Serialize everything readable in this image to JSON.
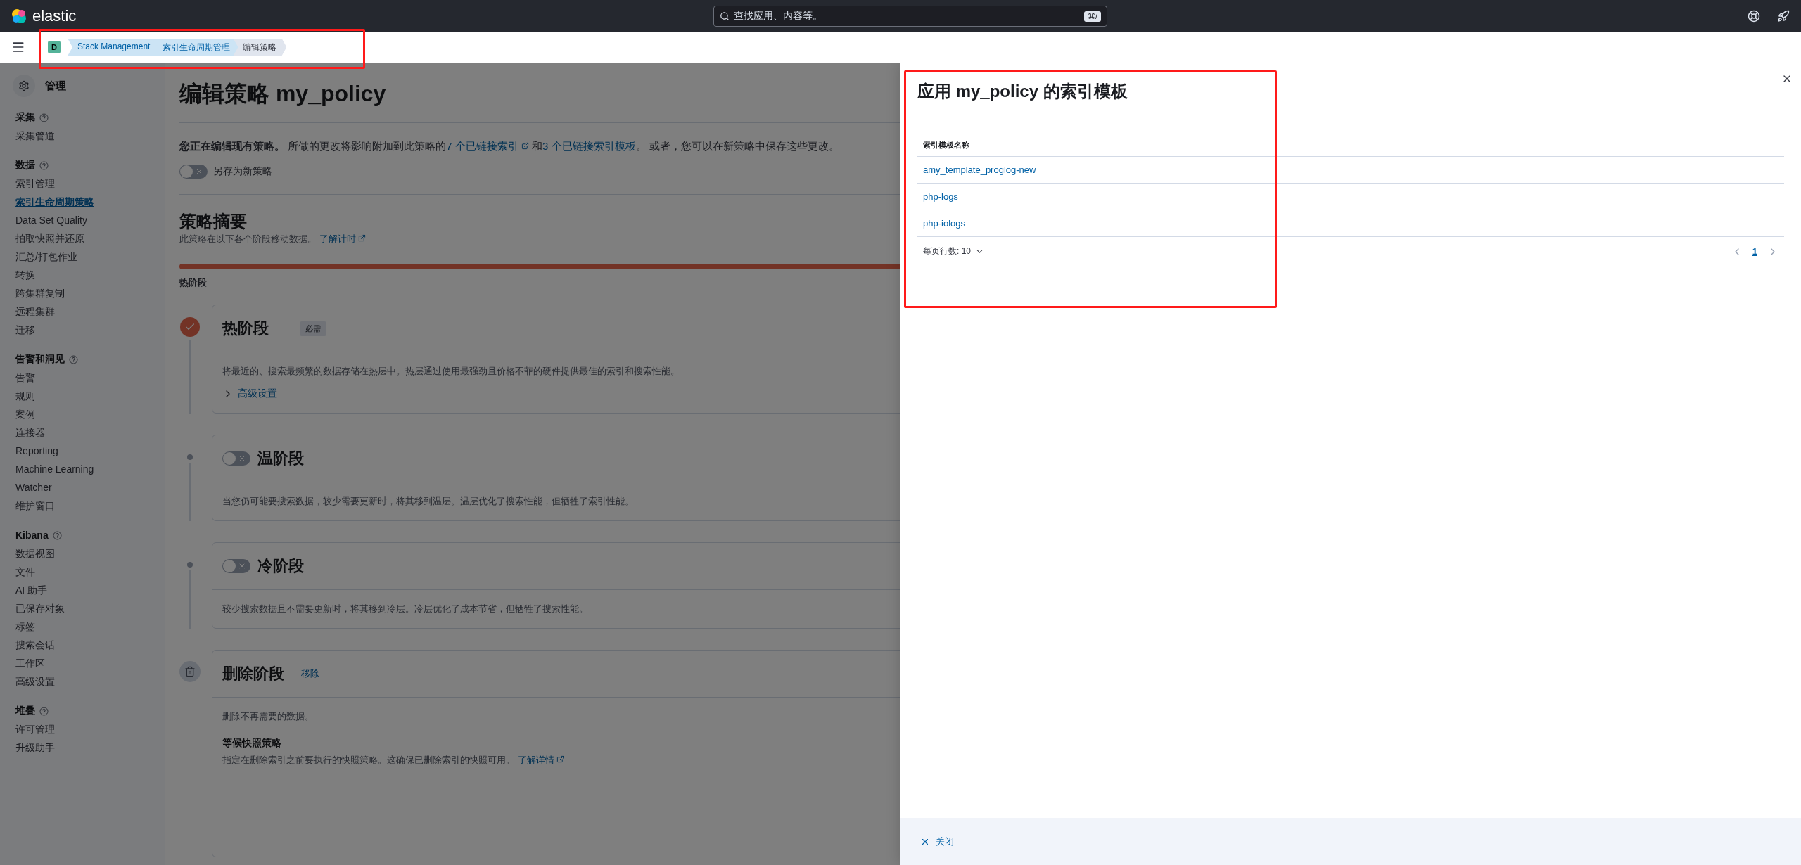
{
  "header": {
    "logo_text": "elastic",
    "search_placeholder": "查找应用、内容等。",
    "search_shortcut": "⌘/"
  },
  "breadcrumbs": {
    "space": "D",
    "items": [
      {
        "label": "Stack Management",
        "selected": false
      },
      {
        "label": "索引生命周期管理",
        "selected": false
      },
      {
        "label": "编辑策略",
        "selected": true
      }
    ]
  },
  "sidebar": {
    "title": "管理",
    "groups": [
      {
        "title": "采集",
        "items": [
          {
            "label": "采集管道",
            "selected": false
          }
        ]
      },
      {
        "title": "数据",
        "items": [
          {
            "label": "索引管理",
            "selected": false
          },
          {
            "label": "索引生命周期策略",
            "selected": true
          },
          {
            "label": "Data Set Quality",
            "selected": false
          },
          {
            "label": "拍取快照并还原",
            "selected": false
          },
          {
            "label": "汇总/打包作业",
            "selected": false
          },
          {
            "label": "转换",
            "selected": false
          },
          {
            "label": "跨集群复制",
            "selected": false
          },
          {
            "label": "远程集群",
            "selected": false
          },
          {
            "label": "迁移",
            "selected": false
          }
        ]
      },
      {
        "title": "告警和洞见",
        "items": [
          {
            "label": "告警",
            "selected": false
          },
          {
            "label": "规则",
            "selected": false
          },
          {
            "label": "案例",
            "selected": false
          },
          {
            "label": "连接器",
            "selected": false
          },
          {
            "label": "Reporting",
            "selected": false
          },
          {
            "label": "Machine Learning",
            "selected": false
          },
          {
            "label": "Watcher",
            "selected": false
          },
          {
            "label": "维护窗口",
            "selected": false
          }
        ]
      },
      {
        "title": "Kibana",
        "items": [
          {
            "label": "数据视图",
            "selected": false
          },
          {
            "label": "文件",
            "selected": false
          },
          {
            "label": "AI 助手",
            "selected": false
          },
          {
            "label": "已保存对象",
            "selected": false
          },
          {
            "label": "标签",
            "selected": false
          },
          {
            "label": "搜索会话",
            "selected": false
          },
          {
            "label": "工作区",
            "selected": false
          },
          {
            "label": "高级设置",
            "selected": false
          }
        ]
      },
      {
        "title": "堆叠",
        "items": [
          {
            "label": "许可管理",
            "selected": false
          },
          {
            "label": "升级助手",
            "selected": false
          }
        ]
      }
    ]
  },
  "page": {
    "title": "编辑策略 my_policy",
    "notice": {
      "lead": "您正在编辑现有策略。",
      "text": "所做的更改将影响附加到此策略的",
      "link_1": "7 个已链接索引",
      "joiner": "和",
      "link_2": "3 个已链接索引模板",
      "tail": "。 或者，您可以在新策略中保存这些更改。"
    },
    "save_as_new": {
      "label": "另存为新策略",
      "on": false
    },
    "summary": {
      "title": "策略摘要",
      "subtitle": "此策略在以下各个阶段移动数据。",
      "link": "了解计时",
      "bar_label": "热阶段"
    },
    "phases": [
      {
        "kind": "hot",
        "title": "热阶段",
        "badge": "必需",
        "description": "将最近的、搜索最频繁的数据存储在热层中。热层通过使用最强劲且价格不菲的硬件提供最佳的索引和搜索性能。",
        "advanced": "高级设置"
      },
      {
        "kind": "warm",
        "title": "温阶段",
        "on": false,
        "description": "当您仍可能要搜索数据，较少需要更新时，将其移到温层。温层优化了搜索性能，但牺牲了索引性能。"
      },
      {
        "kind": "cold",
        "title": "冷阶段",
        "on": false,
        "description": "较少搜索数据且不需要更新时，将其移到冷层。冷层优化了成本节省，但牺牲了搜索性能。"
      },
      {
        "kind": "delete",
        "title": "删除阶段",
        "remove": "移除",
        "description": "删除不再需要的数据。",
        "sub_title": "等候快照策略",
        "sub_text": "指定在删除索引之前要执行的快照策略。这确保已删除索引的快照可用。",
        "sub_link": "了解详情"
      }
    ]
  },
  "flyout": {
    "title": "应用 my_policy 的索引模板",
    "column": "索引模板名称",
    "rows": [
      "amy_template_proglog-new",
      "php-logs",
      "php-iologs"
    ],
    "rows_per_page": "每页行数: 10",
    "pages": [
      {
        "label": "1",
        "selected": true
      }
    ],
    "close": "关闭"
  }
}
